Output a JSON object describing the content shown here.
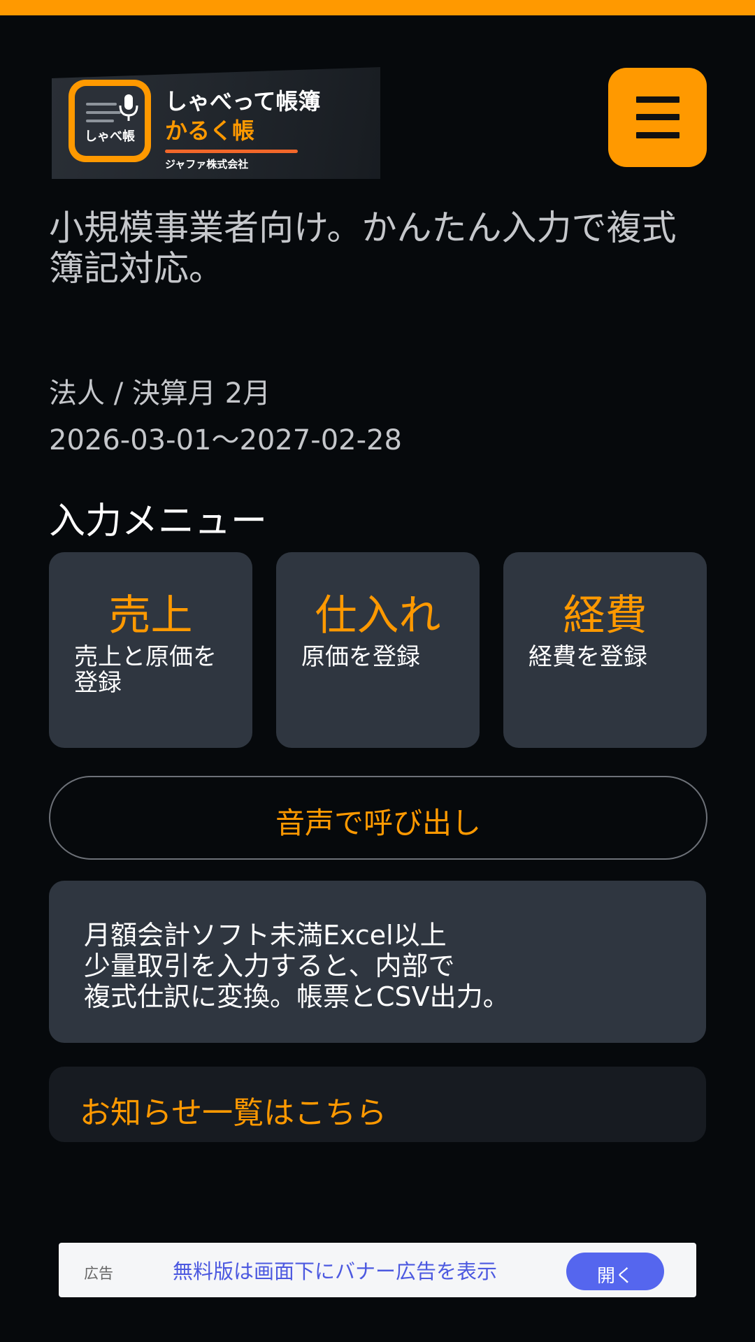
{
  "logo": {
    "badge_text": "しゃべ帳",
    "title_line1": "しゃべって帳簿",
    "title_line2": "かるく帳",
    "company": "ジャファ株式会社"
  },
  "header": {
    "menu_icon": "hamburger-icon"
  },
  "tagline": "小規模事業者向け。かんたん入力で複式簿記対応。",
  "company_info": {
    "type_and_month": "法人 / 決算月 2月",
    "period": "2026-03-01〜2027-02-28"
  },
  "input_menu": {
    "title": "入力メニュー",
    "cards": [
      {
        "title": "売上",
        "desc": "売上と原価を登録"
      },
      {
        "title": "仕入れ",
        "desc": "原価を登録"
      },
      {
        "title": "経費",
        "desc": "経費を登録"
      }
    ]
  },
  "voice_button": {
    "label": "音声で呼び出し"
  },
  "info_box": {
    "line1": "月額会計ソフト未満Excel以上",
    "line2": "少量取引を入力すると、内部で",
    "line3": "複式仕訳に変換。帳票とCSV出力。"
  },
  "notice_link": {
    "label": "お知らせ一覧はこちら"
  },
  "ad_banner": {
    "tag": "広告",
    "text": "無料版は画面下にバナー広告を表示",
    "button_label": "開く"
  },
  "colors": {
    "accent": "#ff9900",
    "background": "#06090c",
    "card": "#2f3640",
    "ad_button": "#5566ee"
  }
}
